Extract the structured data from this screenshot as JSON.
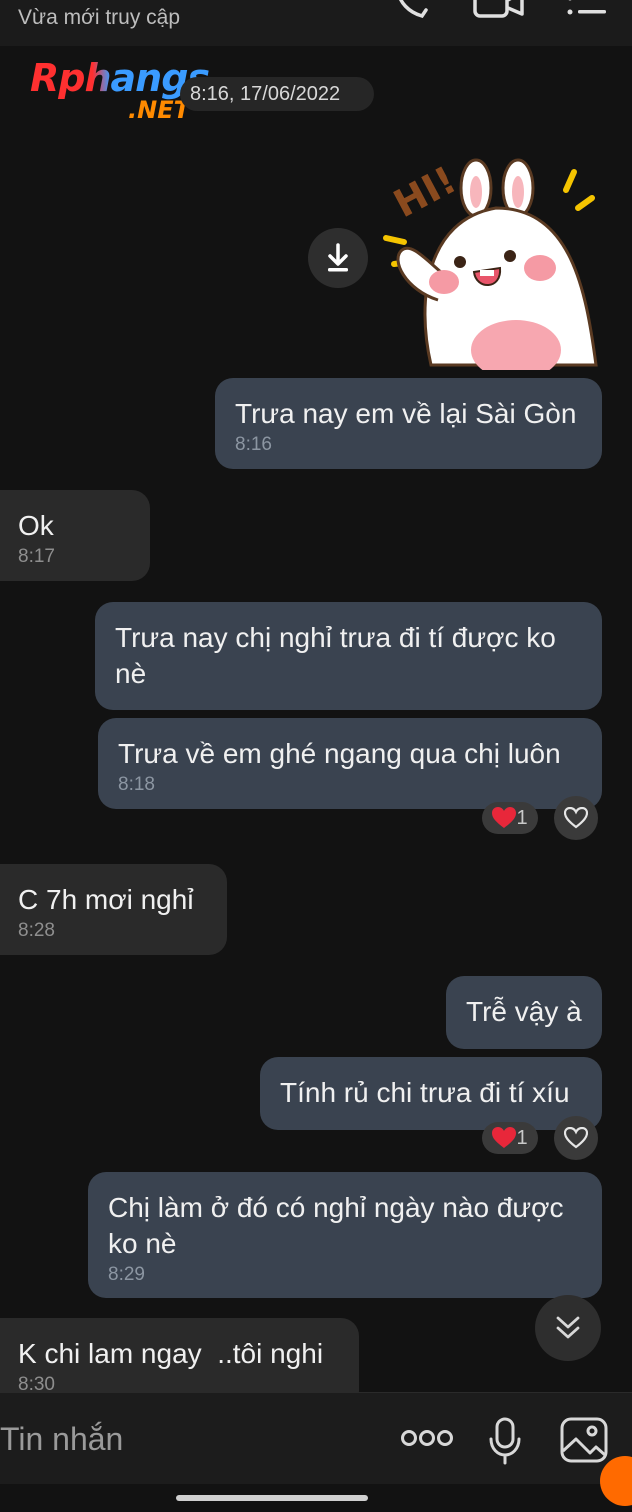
{
  "header": {
    "status": "Vừa mới truy cập"
  },
  "watermark": {
    "line1": "Rphangs",
    "line2": ".NET"
  },
  "date_label": "8:16, 17/06/2022",
  "sticker": {
    "text": "HI!"
  },
  "messages": [
    {
      "text": "Trưa nay em về lại Sài Gòn",
      "time": "8:16"
    },
    {
      "text": "Ok",
      "time": "8:17"
    },
    {
      "text": "Trưa nay chị nghỉ trưa đi tí được ko nè"
    },
    {
      "text": "Trưa về em ghé ngang qua chị luôn",
      "time": "8:18",
      "reaction_count": "1"
    },
    {
      "text": "C 7h mơi nghỉ",
      "time": "8:28"
    },
    {
      "text": "Trễ vậy à"
    },
    {
      "text": "Tính rủ chi trưa đi tí xíu",
      "reaction_count": "1"
    },
    {
      "text": "Chị làm ở đó có nghỉ ngày nào được ko nè",
      "time": "8:29"
    },
    {
      "text": "K chi lam ngay  ..tôi nghi",
      "time": "8:30"
    }
  ],
  "input": {
    "placeholder": "Tin nhắn"
  },
  "colors": {
    "background": "#121212",
    "outgoing_bubble": "#3a4350",
    "incoming_bubble": "#2a2a2a",
    "reaction_heart": "#e8273a"
  },
  "icons": [
    "phone-icon",
    "video-call-icon",
    "menu-icon",
    "download-icon",
    "heart-icon",
    "chevrons-down-icon",
    "more-icon",
    "microphone-icon",
    "image-icon"
  ]
}
